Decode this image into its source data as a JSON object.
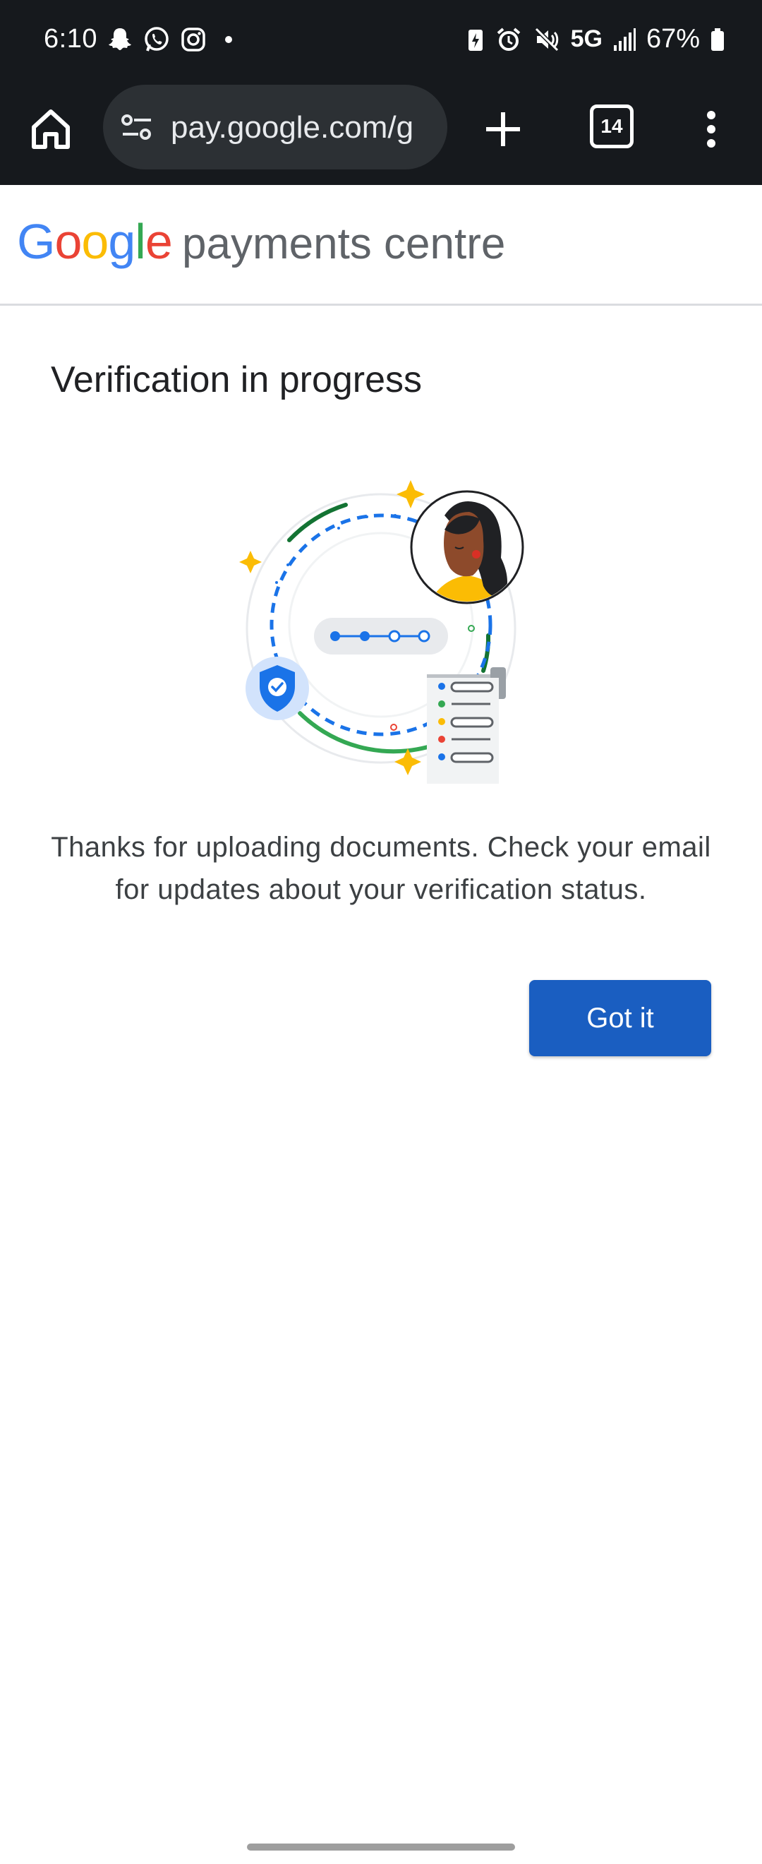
{
  "status_bar": {
    "time": "6:10",
    "network": "5G",
    "battery_percent": "67%",
    "left_icons": [
      "snapchat-icon",
      "whatsapp-icon",
      "instagram-icon",
      "dot-icon"
    ],
    "right_icons": [
      "battery-saver-icon",
      "alarm-icon",
      "mute-icon",
      "signal-icon",
      "battery-icon"
    ]
  },
  "browser": {
    "url": "pay.google.com/g",
    "tab_count": "14"
  },
  "header": {
    "logo_letters": [
      "G",
      "o",
      "o",
      "g",
      "l",
      "e"
    ],
    "title": "payments centre"
  },
  "main": {
    "title": "Verification in progress",
    "message": "Thanks for uploading documents. Check your email for updates about your verification status.",
    "button_label": "Got it"
  },
  "colors": {
    "google_blue": "#4285F4",
    "google_red": "#EA4335",
    "google_yellow": "#FBBC05",
    "google_green": "#34A853",
    "button": "#1a5ec1"
  }
}
